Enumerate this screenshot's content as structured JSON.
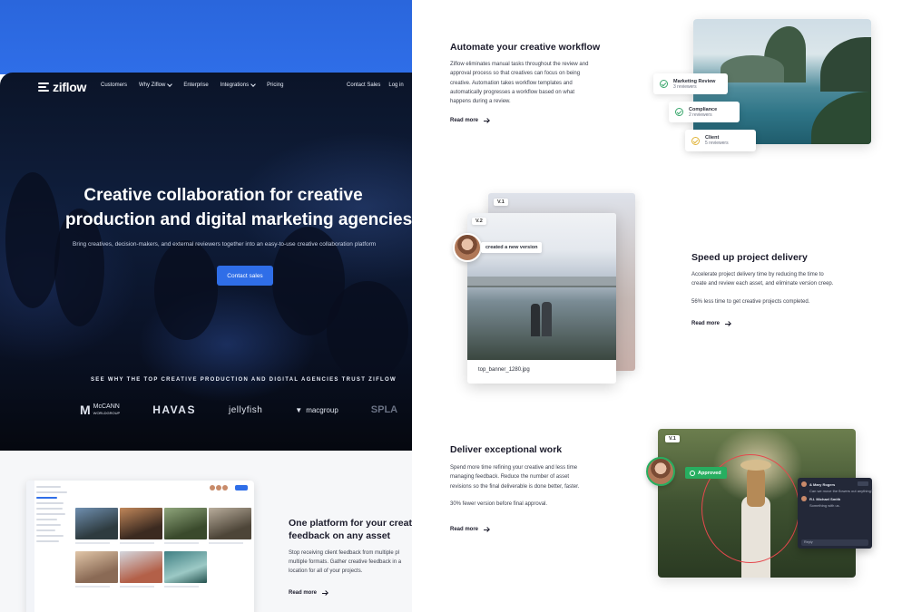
{
  "nav": {
    "logo": "ziflow",
    "items": [
      "Customers",
      "Why Ziflow",
      "Enterprise",
      "Integrations",
      "Pricing"
    ],
    "contact_sales": "Contact Sales",
    "login": "Log in"
  },
  "hero": {
    "title_line1": "Creative collaboration for creative",
    "title_line2": "production and digital marketing agencies",
    "subtitle": "Bring creatives, decision-makers, and external reviewers together into an easy-to-use creative collaboration platform",
    "cta": "Contact sales",
    "trust": "SEE WHY THE TOP CREATIVE PRODUCTION AND DIGITAL AGENCIES TRUST ZIFLOW",
    "logos": {
      "mccann_mark": "M",
      "mccann_line1": "McCANN",
      "mccann_line2": "WORLDGROUP",
      "havas": "HAVAS",
      "jellyfish": "jellyfish",
      "macgroup": "macgroup",
      "splash": "SPLA"
    }
  },
  "platform": {
    "title_line1": "One platform for your creat",
    "title_line2": "feedback on any asset",
    "text": [
      "Stop receiving client feedback from multiple pl",
      "multiple formats. Gather creative feedback in a",
      "location for all of your projects."
    ],
    "read_more": "Read more"
  },
  "automate": {
    "title": "Automate your creative workflow",
    "text": [
      "Ziflow eliminates manual tasks throughout the review and",
      "approval process so that creatives can focus on being",
      "creative. Automation takes workflow templates and",
      "automatically progresses a workflow based on what",
      "happens during a review."
    ],
    "read_more": "Read more",
    "reviews": [
      {
        "name": "Marketing Review",
        "count": "3 reviewers",
        "status": "approved"
      },
      {
        "name": "Compliance",
        "count": "2 reviewers",
        "status": "approved"
      },
      {
        "name": "Client",
        "count": "5 reviewers",
        "status": "pending"
      }
    ]
  },
  "speed": {
    "title": "Speed up project delivery",
    "text": [
      "Accelerate project delivery time by reducing the time to",
      "create and review each asset, and eliminate version creep."
    ],
    "stat": "56% less time to get creative projects completed.",
    "read_more": "Read more",
    "version_back": "V.1",
    "version_front": "V.2",
    "bubble": "created a new version",
    "file_name": "top_banner_1280.jpg"
  },
  "deliver": {
    "title": "Deliver exceptional work",
    "text": [
      "Spend more time refining your creative and less time",
      "managing feedback. Reduce the number of asset",
      "revisions so the final deliverable is done better, faster."
    ],
    "stat": "30% fewer version before final approval.",
    "read_more": "Read more",
    "version": "V.1",
    "approved": "Approved",
    "comments": [
      {
        "name": "& Mary Rogers",
        "text": "Can we move the flowers out anything?"
      },
      {
        "name": "R.I. Michael Smith",
        "text": "Something with us."
      }
    ],
    "reply": "Reply"
  },
  "colors": {
    "brand_blue": "#2f6ee8",
    "approved_green": "#27ae60",
    "annotation_red": "#e5484d"
  }
}
